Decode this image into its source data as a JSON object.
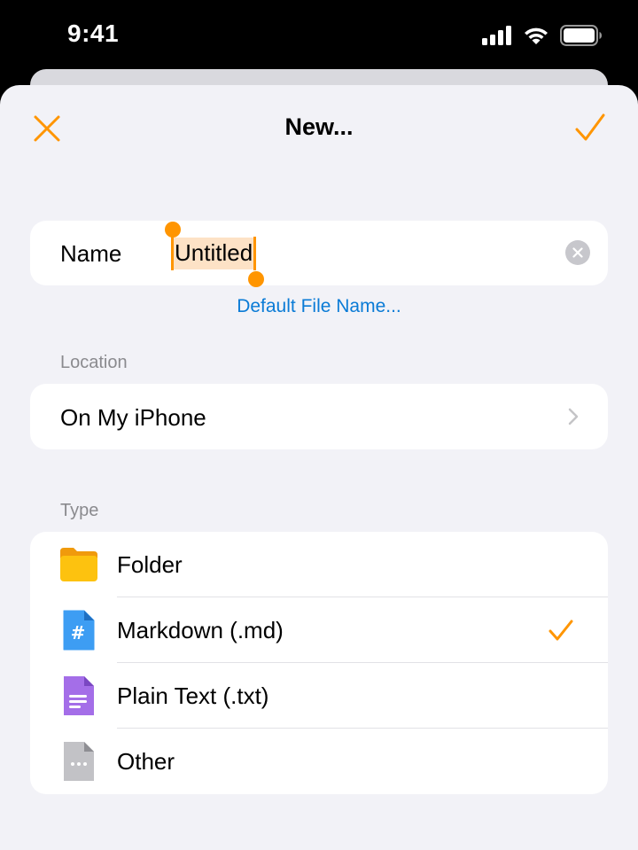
{
  "status_bar": {
    "time": "9:41"
  },
  "nav": {
    "title": "New..."
  },
  "name_field": {
    "label": "Name",
    "value": "Untitled"
  },
  "default_link": "Default File Name...",
  "location": {
    "section_label": "Location",
    "value": "On My iPhone"
  },
  "type": {
    "section_label": "Type",
    "items": [
      {
        "label": "Folder",
        "icon": "folder-icon",
        "selected": false
      },
      {
        "label": "Markdown (.md)",
        "icon": "markdown-file-icon",
        "selected": true
      },
      {
        "label": "Plain Text (.txt)",
        "icon": "text-file-icon",
        "selected": false
      },
      {
        "label": "Other",
        "icon": "other-file-icon",
        "selected": false
      }
    ]
  },
  "colors": {
    "accent": "#ff9500",
    "link": "#0a7bd6",
    "background": "#f2f2f7"
  }
}
